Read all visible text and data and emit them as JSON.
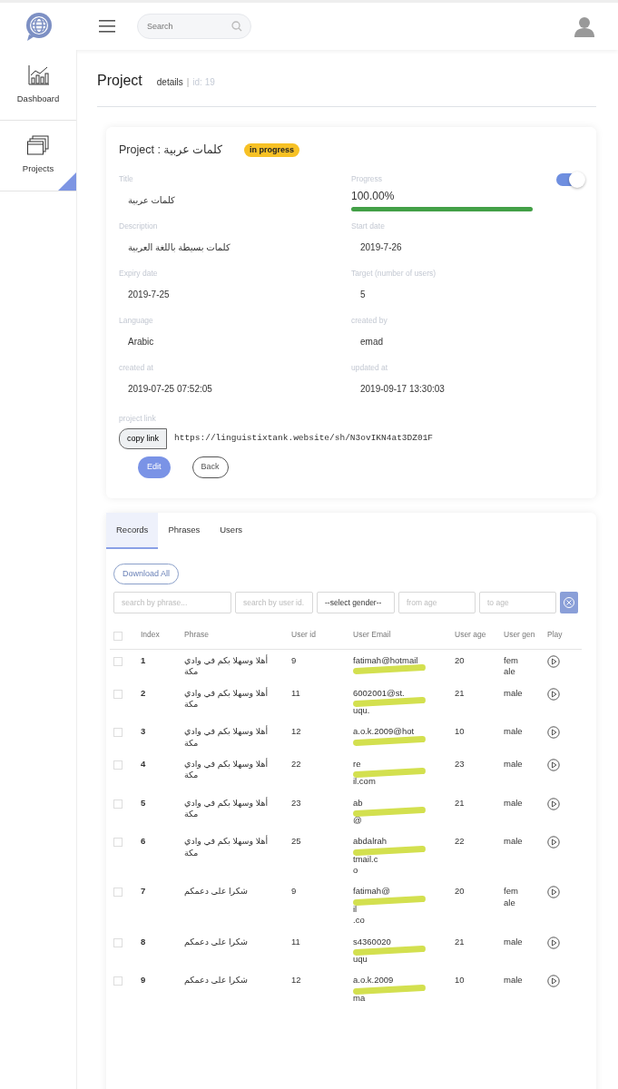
{
  "top_bar": {
    "search": {
      "placeholder": "Search"
    }
  },
  "sidebar": {
    "items": [
      {
        "label": "Dashboard",
        "kind": "chart",
        "selected": false
      },
      {
        "label": "Projects",
        "kind": "stack",
        "selected": true
      }
    ]
  },
  "page_header": {
    "title": "Project",
    "subtitle": "details",
    "separator": "|",
    "id": "id: 19"
  },
  "project_card": {
    "title": "Project : كلمات عربية",
    "status": "in progress",
    "switch_on": true,
    "fields": [
      {
        "label": "Title",
        "value": "كلمات عربية",
        "kind": "text"
      },
      {
        "label": "Progress",
        "value": "100.00%",
        "kind": "progress",
        "level": 1.0
      },
      {
        "label": "Description",
        "value": "كلمات بسيطة باللغة العربية",
        "kind": "text"
      },
      {
        "label": "Start date",
        "value": "2019-7-26",
        "kind": "text"
      },
      {
        "label": "Expiry date",
        "value": "2019-7-25",
        "kind": "text"
      },
      {
        "label": "Target (number of users)",
        "value": "5",
        "kind": "text"
      },
      {
        "label": "Language",
        "value": "Arabic",
        "kind": "text"
      },
      {
        "label": "created by",
        "value": "emad",
        "kind": "text"
      },
      {
        "label": "created at",
        "value": "2019-07-25 07:52:05",
        "kind": "text"
      },
      {
        "label": "updated at",
        "value": "2019-09-17 13:30:03",
        "kind": "text"
      }
    ],
    "link_label": "project link",
    "copy_button": "copy link",
    "link": "https://linguistixtank.website/sh/N3ovIKN4at3DZ01F",
    "buttons": [
      {
        "label": "Edit",
        "kind": "primary"
      },
      {
        "label": "Back",
        "kind": "outline"
      }
    ]
  },
  "tabs": [
    {
      "label": "Records",
      "selected": true
    },
    {
      "label": "Phrases",
      "selected": false
    },
    {
      "label": "Users",
      "selected": false
    }
  ],
  "download_button": "Download All",
  "filters": [
    {
      "kind": "input",
      "placeholder": "search by phrase..."
    },
    {
      "kind": "input",
      "placeholder": "search by user id."
    },
    {
      "kind": "select",
      "value": "--select gender--"
    },
    {
      "kind": "input",
      "placeholder": "from age"
    },
    {
      "kind": "input",
      "placeholder": "to age"
    }
  ],
  "table": {
    "select_all_checked": false,
    "columns": [
      "Index",
      "Phrase",
      "User id",
      "User Email",
      "User age",
      "User gen",
      "Play"
    ],
    "rows": [
      {
        "checked": false,
        "index": "1",
        "phrase": "أهلا وسهلا بكم في وادي مكة",
        "user_id": "9",
        "email_lines": [
          "fatimah@hotmail"
        ],
        "redacted": true,
        "age": "20",
        "gender": "female"
      },
      {
        "checked": false,
        "index": "2",
        "phrase": "أهلا وسهلا بكم في وادي مكة",
        "user_id": "11",
        "email_lines": [
          "6002001@st.",
          "uqu."
        ],
        "redacted": true,
        "age": "21",
        "gender": "male"
      },
      {
        "checked": false,
        "index": "3",
        "phrase": "أهلا وسهلا بكم في وادي مكة",
        "user_id": "12",
        "email_lines": [
          "a.o.k.2009@hot"
        ],
        "redacted": true,
        "age": "10",
        "gender": "male"
      },
      {
        "checked": false,
        "index": "4",
        "phrase": "أهلا وسهلا بكم في وادي مكة",
        "user_id": "22",
        "email_lines": [
          "re",
          "il.com"
        ],
        "redacted": true,
        "age": "23",
        "gender": "male"
      },
      {
        "checked": false,
        "index": "5",
        "phrase": "أهلا وسهلا بكم في وادي مكة",
        "user_id": "23",
        "email_lines": [
          "ab",
          "@"
        ],
        "redacted": true,
        "age": "21",
        "gender": "male"
      },
      {
        "checked": false,
        "index": "6",
        "phrase": "أهلا وسهلا بكم في وادي مكة",
        "user_id": "25",
        "email_lines": [
          "abdalrah",
          "tmail.c",
          "o"
        ],
        "redacted": true,
        "age": "22",
        "gender": "male"
      },
      {
        "checked": false,
        "index": "7",
        "phrase": "شكرا على دعمكم",
        "user_id": "9",
        "email_lines": [
          "fatimah@",
          "il",
          ".co"
        ],
        "redacted": true,
        "age": "20",
        "gender": "female"
      },
      {
        "checked": false,
        "index": "8",
        "phrase": "شكرا على دعمكم",
        "user_id": "11",
        "email_lines": [
          "s4360020",
          "uqu"
        ],
        "redacted": true,
        "age": "21",
        "gender": "male"
      },
      {
        "checked": false,
        "index": "9",
        "phrase": "شكرا على دعمكم",
        "user_id": "12",
        "email_lines": [
          "a.o.k.2009",
          "ma"
        ],
        "redacted": true,
        "age": "10",
        "gender": "male"
      }
    ]
  }
}
